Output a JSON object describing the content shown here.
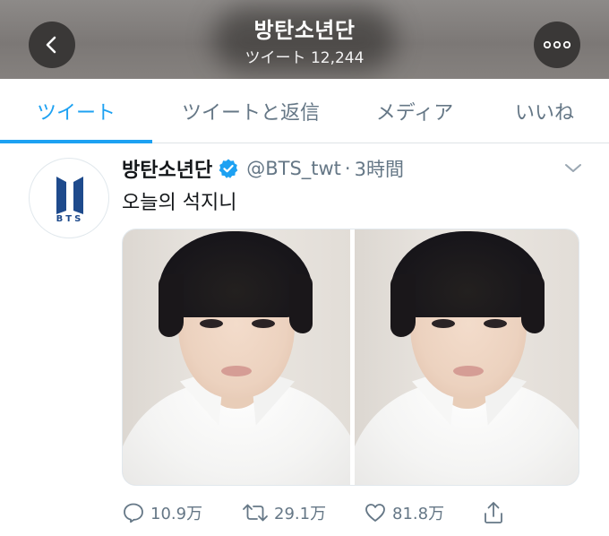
{
  "header": {
    "title": "방탄소년단",
    "subtitle": "ツイート 12,244",
    "back_icon": "back-chevron-icon",
    "more_icon": "ellipsis-icon"
  },
  "tabs": [
    {
      "label": "ツイート",
      "active": true
    },
    {
      "label": "ツイートと返信",
      "active": false
    },
    {
      "label": "メディア",
      "active": false
    },
    {
      "label": "いいね",
      "active": false
    }
  ],
  "tweet": {
    "avatar_text": "BTS",
    "user_name": "방탄소년단",
    "verified": true,
    "handle": "@BTS_twt",
    "separator": "·",
    "time": "3時間",
    "text": "오늘의 석지니",
    "media_count": 2,
    "actions": {
      "reply": "10.9万",
      "retweet": "29.1万",
      "like": "81.8万"
    }
  },
  "colors": {
    "accent": "#1da1f2",
    "secondary_text": "#657786",
    "verified": "#1da1f2"
  }
}
